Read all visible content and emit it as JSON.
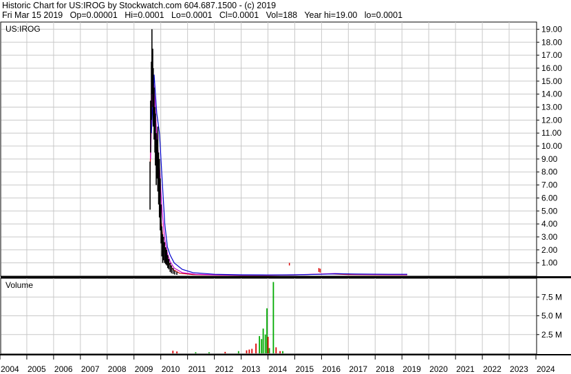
{
  "header": {
    "line1": "Historic Chart for US:IROG by Stockwatch.com 604.687.1500 - (c) 2019",
    "line2": "Fri Mar 15 2019   Op=0.00001   Hi=0.0001   Lo=0.0001   Cl=0.0001   Vol=188   Year hi=19.00   lo=0.0001"
  },
  "chart_data": [
    {
      "type": "line",
      "title": "US:IROG",
      "ylim": [
        0,
        19.5
      ],
      "y_ticks": [
        "1.00",
        "2.00",
        "3.00",
        "4.00",
        "5.00",
        "6.00",
        "7.00",
        "8.00",
        "9.00",
        "10.00",
        "11.00",
        "12.00",
        "13.00",
        "14.00",
        "15.00",
        "16.00",
        "17.00",
        "18.00",
        "19.00"
      ],
      "grid": true,
      "colors": {
        "price": "#000000",
        "ma_short": "#cc0000",
        "ma_mid": "#cc00cc",
        "ma_long": "#0000cc",
        "spike": "#dd0000"
      },
      "price_ranges": [
        {
          "t": 2009.6,
          "lo": 5.1,
          "hi": 8.8
        },
        {
          "t": 2009.62,
          "lo": 9.5,
          "hi": 13.5
        },
        {
          "t": 2009.65,
          "lo": 12.0,
          "hi": 16.5
        },
        {
          "t": 2009.67,
          "lo": 14.0,
          "hi": 19.0
        },
        {
          "t": 2009.7,
          "lo": 13.0,
          "hi": 17.5
        },
        {
          "t": 2009.72,
          "lo": 11.5,
          "hi": 16.0
        },
        {
          "t": 2009.75,
          "lo": 10.5,
          "hi": 14.5
        },
        {
          "t": 2009.78,
          "lo": 9.5,
          "hi": 13.0
        },
        {
          "t": 2009.8,
          "lo": 8.5,
          "hi": 12.5
        },
        {
          "t": 2009.83,
          "lo": 7.0,
          "hi": 11.0
        },
        {
          "t": 2009.86,
          "lo": 7.5,
          "hi": 10.5
        },
        {
          "t": 2009.89,
          "lo": 6.5,
          "hi": 11.5
        },
        {
          "t": 2009.92,
          "lo": 5.5,
          "hi": 9.5
        },
        {
          "t": 2009.95,
          "lo": 4.5,
          "hi": 9.0
        },
        {
          "t": 2009.98,
          "lo": 3.5,
          "hi": 7.5
        },
        {
          "t": 2010.01,
          "lo": 2.5,
          "hi": 5.5
        },
        {
          "t": 2010.04,
          "lo": 1.5,
          "hi": 3.8
        },
        {
          "t": 2010.07,
          "lo": 1.0,
          "hi": 3.2
        },
        {
          "t": 2010.1,
          "lo": 1.2,
          "hi": 3.0
        },
        {
          "t": 2010.14,
          "lo": 1.0,
          "hi": 2.6
        },
        {
          "t": 2010.18,
          "lo": 0.9,
          "hi": 2.2
        },
        {
          "t": 2010.22,
          "lo": 0.8,
          "hi": 2.0
        },
        {
          "t": 2010.26,
          "lo": 0.6,
          "hi": 1.6
        },
        {
          "t": 2010.3,
          "lo": 0.5,
          "hi": 1.3
        },
        {
          "t": 2010.35,
          "lo": 0.3,
          "hi": 1.0
        },
        {
          "t": 2010.4,
          "lo": 0.2,
          "hi": 0.8
        },
        {
          "t": 2010.46,
          "lo": 0.15,
          "hi": 0.6
        },
        {
          "t": 2010.52,
          "lo": 0.1,
          "hi": 0.4
        },
        {
          "t": 2010.6,
          "lo": 0.08,
          "hi": 0.3
        }
      ],
      "series": [
        {
          "color_key": "ma_short",
          "points": [
            [
              2009.6,
              7.5
            ],
            [
              2009.67,
              15.5
            ],
            [
              2009.75,
              12.5
            ],
            [
              2009.83,
              9.0
            ],
            [
              2009.92,
              7.5
            ],
            [
              2010.0,
              4.5
            ],
            [
              2010.1,
              2.5
            ],
            [
              2010.2,
              1.6
            ],
            [
              2010.3,
              1.0
            ],
            [
              2010.45,
              0.5
            ],
            [
              2010.7,
              0.2
            ],
            [
              2011.2,
              0.1
            ],
            [
              2012.0,
              0.07
            ],
            [
              2013.0,
              0.05
            ],
            [
              2014.0,
              0.05
            ],
            [
              2015.0,
              0.07
            ],
            [
              2015.8,
              0.12
            ],
            [
              2016.3,
              0.15
            ],
            [
              2017.0,
              0.1
            ],
            [
              2018.5,
              0.08
            ],
            [
              2019.2,
              0.08
            ]
          ]
        },
        {
          "color_key": "ma_mid",
          "points": [
            [
              2009.62,
              9.0
            ],
            [
              2009.7,
              16.0
            ],
            [
              2009.78,
              13.5
            ],
            [
              2009.86,
              10.5
            ],
            [
              2009.95,
              8.5
            ],
            [
              2010.05,
              5.0
            ],
            [
              2010.15,
              2.8
            ],
            [
              2010.25,
              1.7
            ],
            [
              2010.35,
              1.1
            ],
            [
              2010.5,
              0.6
            ],
            [
              2010.8,
              0.25
            ],
            [
              2011.3,
              0.12
            ],
            [
              2012.0,
              0.08
            ],
            [
              2013.0,
              0.06
            ],
            [
              2014.0,
              0.06
            ],
            [
              2015.0,
              0.08
            ],
            [
              2016.0,
              0.14
            ],
            [
              2016.5,
              0.18
            ],
            [
              2017.2,
              0.12
            ],
            [
              2018.5,
              0.1
            ],
            [
              2019.2,
              0.1
            ]
          ]
        },
        {
          "color_key": "ma_long",
          "points": [
            [
              2009.65,
              11.0
            ],
            [
              2009.75,
              15.5
            ],
            [
              2009.85,
              12.5
            ],
            [
              2009.95,
              11.0
            ],
            [
              2010.05,
              7.5
            ],
            [
              2010.15,
              4.0
            ],
            [
              2010.25,
              2.2
            ],
            [
              2010.35,
              1.6
            ],
            [
              2010.5,
              1.0
            ],
            [
              2010.8,
              0.5
            ],
            [
              2011.2,
              0.25
            ],
            [
              2012.0,
              0.12
            ],
            [
              2013.0,
              0.08
            ],
            [
              2014.0,
              0.07
            ],
            [
              2015.0,
              0.08
            ],
            [
              2016.0,
              0.12
            ],
            [
              2016.6,
              0.16
            ],
            [
              2017.3,
              0.14
            ],
            [
              2018.5,
              0.12
            ],
            [
              2019.2,
              0.12
            ]
          ]
        }
      ],
      "spikes": [
        {
          "t": 2014.8,
          "lo": 0.8,
          "hi": 1.0
        },
        {
          "t": 2015.9,
          "lo": 0.3,
          "hi": 0.6
        },
        {
          "t": 2015.95,
          "lo": 0.25,
          "hi": 0.55
        }
      ]
    },
    {
      "type": "bar",
      "title": "Volume",
      "ylim": [
        0,
        10
      ],
      "y_ticks": [
        "2.5 M",
        "5.0 M",
        "7.5 M"
      ],
      "y_tick_values": [
        2.5,
        5.0,
        7.5
      ],
      "grid": true,
      "colors": {
        "up": "#00aa00",
        "down": "#dd0000"
      },
      "bars": [
        {
          "t": 2010.45,
          "v": 0.35,
          "c": "down"
        },
        {
          "t": 2010.6,
          "v": 0.25,
          "c": "down"
        },
        {
          "t": 2011.3,
          "v": 0.15,
          "c": "up"
        },
        {
          "t": 2011.8,
          "v": 0.15,
          "c": "up"
        },
        {
          "t": 2012.4,
          "v": 0.2,
          "c": "down"
        },
        {
          "t": 2012.9,
          "v": 0.3,
          "c": "up"
        },
        {
          "t": 2013.2,
          "v": 0.4,
          "c": "down"
        },
        {
          "t": 2013.3,
          "v": 0.5,
          "c": "down"
        },
        {
          "t": 2013.4,
          "v": 0.6,
          "c": "down"
        },
        {
          "t": 2013.55,
          "v": 1.3,
          "c": "down"
        },
        {
          "t": 2013.68,
          "v": 2.3,
          "c": "up"
        },
        {
          "t": 2013.76,
          "v": 1.9,
          "c": "up"
        },
        {
          "t": 2013.82,
          "v": 3.3,
          "c": "up"
        },
        {
          "t": 2013.9,
          "v": 2.5,
          "c": "up"
        },
        {
          "t": 2013.96,
          "v": 6.0,
          "c": "up"
        },
        {
          "t": 2014.0,
          "v": 2.2,
          "c": "down"
        },
        {
          "t": 2014.05,
          "v": 0.7,
          "c": "up"
        },
        {
          "t": 2014.2,
          "v": 9.5,
          "c": "up"
        },
        {
          "t": 2014.3,
          "v": 0.8,
          "c": "down"
        },
        {
          "t": 2014.45,
          "v": 0.3,
          "c": "down"
        },
        {
          "t": 2014.55,
          "v": 0.3,
          "c": "up"
        }
      ]
    }
  ],
  "years": [
    "2004",
    "2005",
    "2006",
    "2007",
    "2008",
    "2009",
    "2010",
    "2011",
    "2012",
    "2013",
    "2014",
    "2015",
    "2016",
    "2017",
    "2018",
    "2019",
    "2020",
    "2021",
    "2022",
    "2023",
    "2024"
  ]
}
